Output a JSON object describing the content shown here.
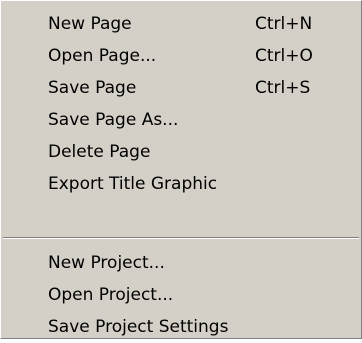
{
  "menu": {
    "file_items": [
      {
        "label": "New Page",
        "shortcut": "Ctrl+N"
      },
      {
        "label": "Open Page...",
        "shortcut": "Ctrl+O"
      },
      {
        "label": "Save Page",
        "shortcut": "Ctrl+S"
      },
      {
        "label": "Save Page As...",
        "shortcut": ""
      },
      {
        "label": "Delete Page",
        "shortcut": ""
      },
      {
        "label": "Export Title Graphic",
        "shortcut": ""
      }
    ],
    "project_items": [
      {
        "label": "New Project..."
      },
      {
        "label": "Open Project..."
      },
      {
        "label": "Save Project Settings"
      }
    ]
  }
}
